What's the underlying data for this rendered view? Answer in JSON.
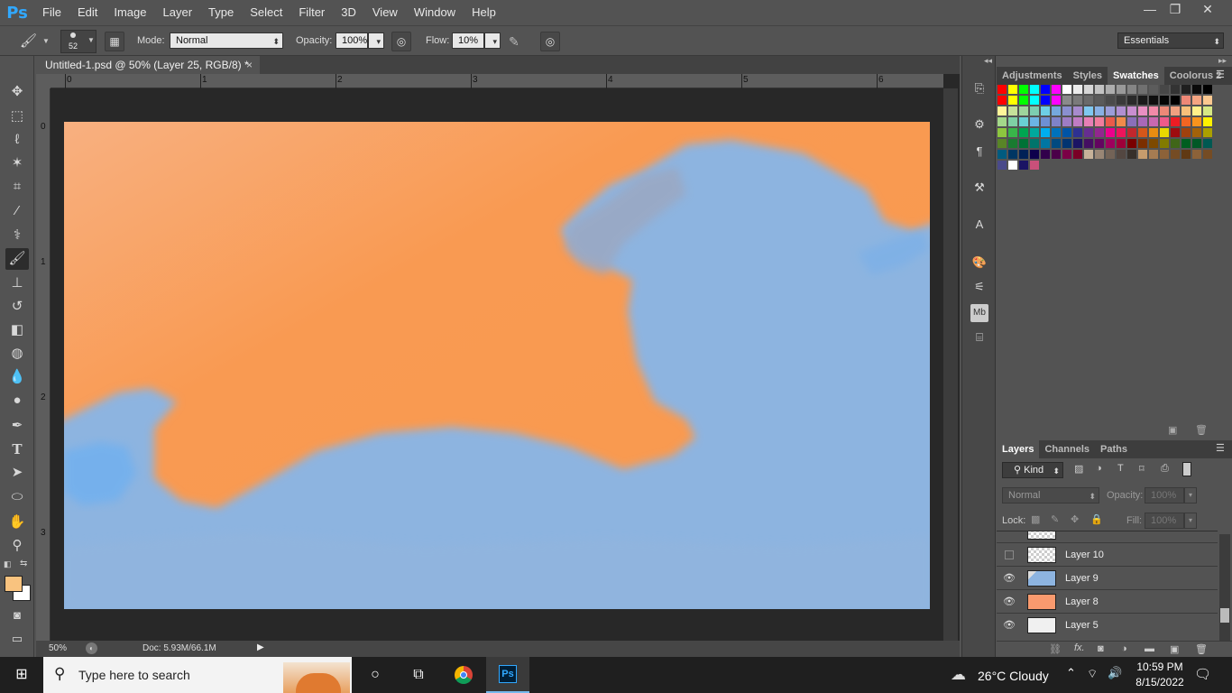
{
  "app": {
    "logo": "Ps"
  },
  "menu": [
    "File",
    "Edit",
    "Image",
    "Layer",
    "Type",
    "Select",
    "Filter",
    "3D",
    "View",
    "Window",
    "Help"
  ],
  "window_controls": {
    "minimize": "—",
    "restore": "❐",
    "close": "✕"
  },
  "options": {
    "brush_size": "52",
    "mode_label": "Mode:",
    "mode_value": "Normal",
    "opacity_label": "Opacity:",
    "opacity_value": "100%",
    "flow_label": "Flow:",
    "flow_value": "10%",
    "workspace": "Essentials"
  },
  "document": {
    "tab_title": "Untitled-1.psd @ 50% (Layer 25, RGB/8) *",
    "close": "×",
    "ruler_top": [
      "0",
      "1",
      "2",
      "3",
      "4",
      "5",
      "6"
    ],
    "ruler_left": [
      "0",
      "1",
      "2",
      "3"
    ],
    "zoom": "50%",
    "doc_size": "Doc: 5.93M/66.1M"
  },
  "upper_panel": {
    "tabs": [
      "Adjustments",
      "Styles",
      "Swatches",
      "Coolorus 2"
    ],
    "active": "Swatches"
  },
  "swatches": [
    "#ff0000",
    "#ffff00",
    "#00ff00",
    "#00ffff",
    "#0000ff",
    "#ff00ff",
    "#ffffff",
    "#ebebeb",
    "#d6d6d6",
    "#c2c2c2",
    "#adadad",
    "#999999",
    "#858585",
    "#707070",
    "#5c5c5c",
    "#474747",
    "#333333",
    "#1f1f1f",
    "#0a0a0a",
    "#000000",
    "#ff0000",
    "#ffff00",
    "#00ff00",
    "#00ffff",
    "#0000ff",
    "#ff00ff",
    "#8a8a8a",
    "#7a7a7a",
    "#6a6a6a",
    "#5a5a5a",
    "#4a4a4a",
    "#3a3a3a",
    "#2a2a2a",
    "#1a1a1a",
    "#0f0f0f",
    "#050505",
    "#000000",
    "#ee8877",
    "#f5a582",
    "#fbc890",
    "#fff59a",
    "#c6e09a",
    "#9fd49c",
    "#7dcdb0",
    "#6dcfe6",
    "#75a8dc",
    "#8a8fcf",
    "#a78bcd",
    "#7fc8f0",
    "#88b0e4",
    "#9b9dd8",
    "#b08fd2",
    "#c88ed0",
    "#e88fc2",
    "#f28aa8",
    "#ee8877",
    "#f0a080",
    "#f8c07a",
    "#fff08a",
    "#d6e884",
    "#a4d88a",
    "#7ed0a4",
    "#6ad0d4",
    "#6cb4e4",
    "#6e90d4",
    "#7f82c8",
    "#9e7cc4",
    "#c07cc4",
    "#e67fb6",
    "#f07c9e",
    "#ea5a4a",
    "#f08a4a",
    "#8a6fb8",
    "#a868b8",
    "#c968b0",
    "#ee5a8a",
    "#ed1c24",
    "#f26522",
    "#f7941d",
    "#fff200",
    "#8dc63f",
    "#39b54a",
    "#00a651",
    "#00a99d",
    "#00aeef",
    "#0072bc",
    "#0054a6",
    "#2e3192",
    "#662d91",
    "#92278f",
    "#ec008c",
    "#ed145b",
    "#c1272d",
    "#d4571a",
    "#e88c12",
    "#e8d900",
    "#9e0b0f",
    "#a0410d",
    "#a36209",
    "#aba000",
    "#598527",
    "#197b30",
    "#007236",
    "#00746b",
    "#0076a3",
    "#004a80",
    "#003471",
    "#1b1464",
    "#440e62",
    "#630460",
    "#9e005d",
    "#9e0039",
    "#790000",
    "#7b2e00",
    "#7d4900",
    "#827b00",
    "#406618",
    "#005e20",
    "#005826",
    "#005952",
    "#005b7f",
    "#003663",
    "#002157",
    "#0d004c",
    "#32004b",
    "#4b0049",
    "#7b0046",
    "#7a0026",
    "#c7b299",
    "#998675",
    "#736357",
    "#534741",
    "#37302a",
    "#c69c6d",
    "#a67c52",
    "#8c6239",
    "#754c24",
    "#603913",
    "#8c6239",
    "#754c24",
    "#4a4a8a",
    "#ffffff",
    "#1a1464",
    "#c9507a"
  ],
  "layers_panel": {
    "tabs": [
      "Layers",
      "Channels",
      "Paths"
    ],
    "kind": "Kind",
    "blend": "Normal",
    "opacity_label": "Opacity:",
    "opacity_value": "100%",
    "lock_label": "Lock:",
    "fill_label": "Fill:",
    "fill_value": "100%",
    "layers": [
      {
        "name": "Layer 10",
        "visible": false,
        "thumb": "checker"
      },
      {
        "name": "Layer 9",
        "visible": true,
        "thumb": "blue"
      },
      {
        "name": "Layer 8",
        "visible": true,
        "thumb": "orange"
      },
      {
        "name": "Layer 5",
        "visible": true,
        "thumb": "white"
      }
    ]
  },
  "colors": {
    "foreground": "#f9c37f",
    "background": "#ffffff",
    "canvas_orange": "#f99a4e",
    "canvas_blue": "#8db4e0"
  },
  "taskbar": {
    "search_placeholder": "Type here to search",
    "weather": "26°C  Cloudy",
    "time": "10:59 PM",
    "date": "8/15/2022"
  }
}
